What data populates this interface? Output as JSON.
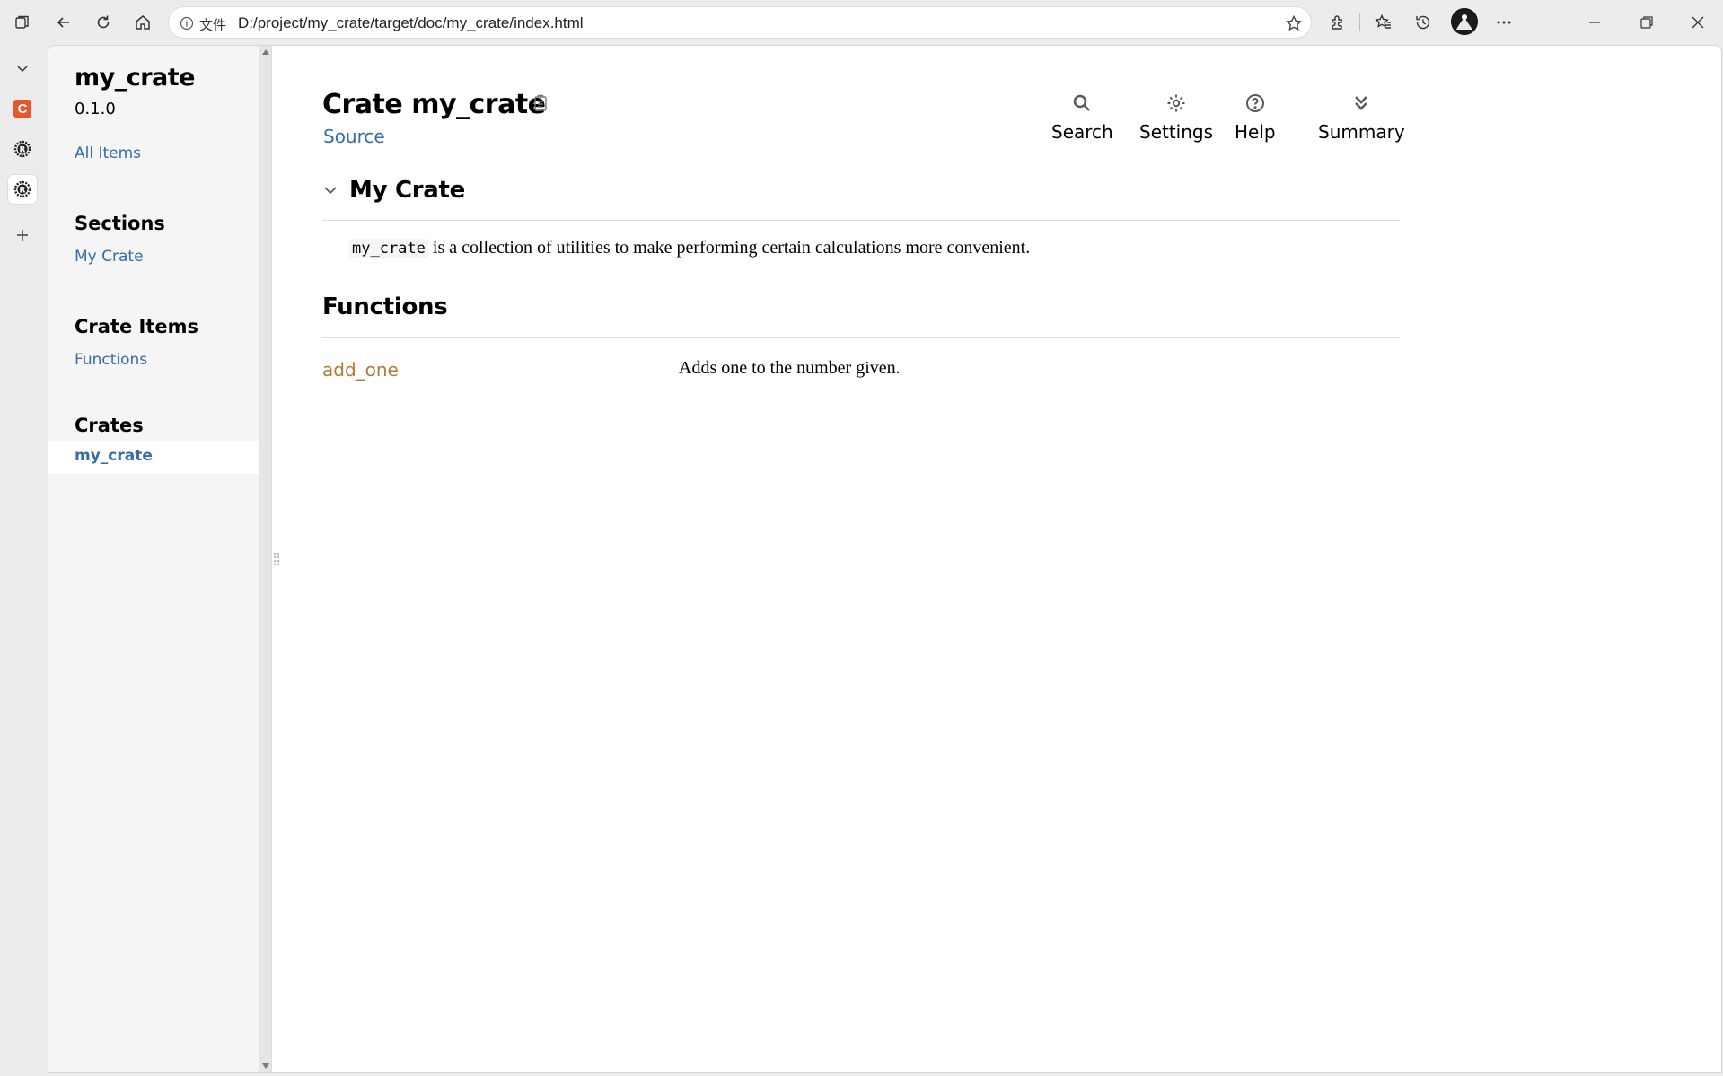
{
  "browser": {
    "address": {
      "label": "文件",
      "url": "D:/project/my_crate/target/doc/my_crate/index.html"
    },
    "left_tabs": [
      {
        "name": "collapse-tabs",
        "icon": "chevron-down-icon"
      },
      {
        "name": "tab-c",
        "icon": "c-icon",
        "glyph": "C"
      },
      {
        "name": "tab-rust-docs-1",
        "icon": "rust-icon"
      },
      {
        "name": "tab-rust-docs-2",
        "icon": "rust-icon",
        "active": true
      },
      {
        "name": "new-tab",
        "icon": "plus-icon"
      }
    ]
  },
  "sidebar": {
    "crate_name": "my_crate",
    "version": "0.1.0",
    "all_items": "All Items",
    "sections_heading": "Sections",
    "sections": [
      "My Crate"
    ],
    "crate_items_heading": "Crate Items",
    "crate_items": [
      "Functions"
    ],
    "crates_heading": "Crates",
    "crates": [
      "my_crate"
    ]
  },
  "main": {
    "title": "Crate my_crate",
    "source_label": "Source",
    "toolbar": {
      "search": "Search",
      "settings": "Settings",
      "help": "Help",
      "summary": "Summary"
    },
    "section_heading": "My Crate",
    "description": {
      "code": "my_crate",
      "text": " is a collection of utilities to make performing certain calculations more convenient."
    },
    "functions_heading": "Functions",
    "functions": [
      {
        "name": "add_one",
        "description": "Adds one to the number given."
      }
    ]
  },
  "colors": {
    "link": "#356da4",
    "function_link": "#ad7c37",
    "sidebar_bg": "#f5f5f5",
    "chrome_bg": "#ececec"
  }
}
